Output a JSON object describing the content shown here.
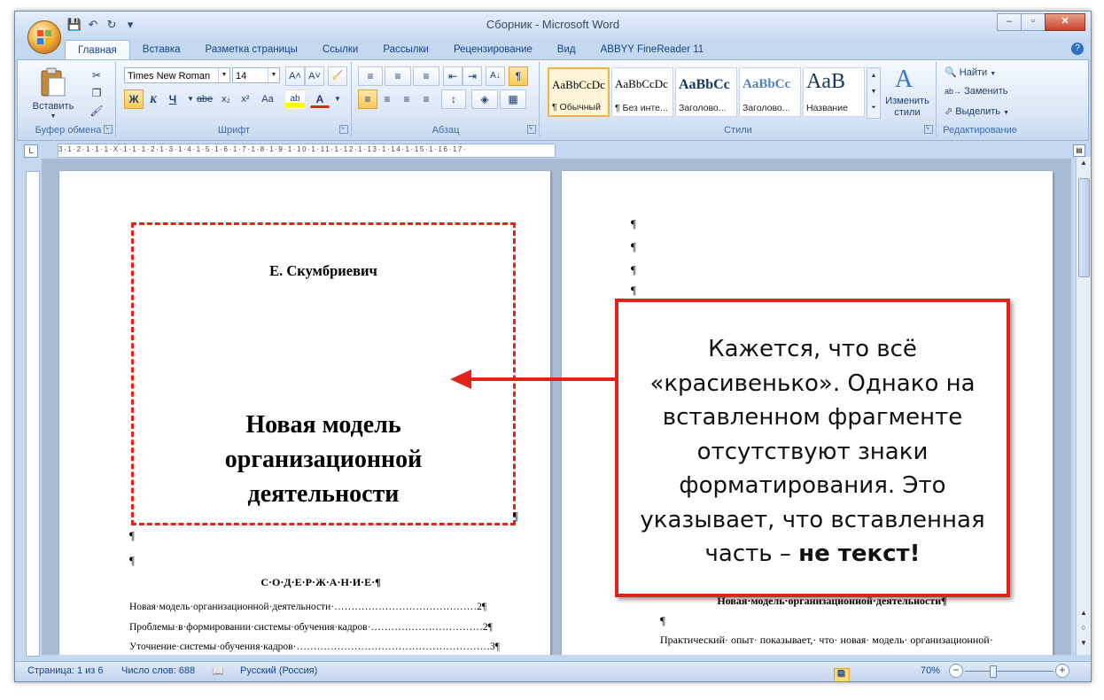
{
  "window": {
    "title": "Сборник - Microsoft Word",
    "controls": {
      "minimize": "–",
      "maximize": "▫",
      "close": "✕"
    }
  },
  "quick_access": [
    "save-icon",
    "undo-icon",
    "redo-icon",
    "customize-icon"
  ],
  "tabs": [
    "Главная",
    "Вставка",
    "Разметка страницы",
    "Ссылки",
    "Рассылки",
    "Рецензирование",
    "Вид",
    "ABBYY FineReader 11"
  ],
  "ribbon": {
    "clipboard": {
      "paste_label": "Вставить",
      "group_label": "Буфер обмена"
    },
    "font": {
      "font_name": "Times New Roman",
      "font_size": "14",
      "group_label": "Шрифт",
      "bold": "Ж",
      "italic": "К",
      "underline": "Ч",
      "strike": "abe",
      "sub": "x₂",
      "sup": "x²",
      "case": "Aa",
      "grow": "A˄",
      "shrink": "A˅",
      "clear": "A"
    },
    "paragraph": {
      "group_label": "Абзац"
    },
    "styles": {
      "group_label": "Стили",
      "items": [
        {
          "sample": "AaBbCcDc",
          "name": "¶ Обычный"
        },
        {
          "sample": "AaBbCcDc",
          "name": "¶ Без инте..."
        },
        {
          "sample": "AaBbCc",
          "name": "Заголово..."
        },
        {
          "sample": "AaBbCc",
          "name": "Заголово..."
        },
        {
          "sample": "AaB",
          "name": "Название"
        }
      ],
      "change_styles_line1": "Изменить",
      "change_styles_line2": "стили"
    },
    "editing": {
      "group_label": "Редактирование",
      "find": "Найти",
      "replace": "Заменить",
      "select": "Выделить"
    }
  },
  "ruler": {
    "tab_selector": "L",
    "marks": "3·1·2·1·1·1·X·1·1·1·2·1·3·1·4·1·5·1·6·1·7·1·8·1·9·1·10·1·11·1·12·1·13·1·14·1·15·1·16·17·"
  },
  "page1": {
    "author": "Е. Скумбриевич",
    "title_line1": "Новая модель",
    "title_line2": "организационной",
    "title_line3": "деятельности",
    "pilcrow": "¶",
    "contents_heading": "С·О·Д·Е·Р·Ж·А·Н·И·Е·¶",
    "toc": [
      {
        "text": "Новая·модель·организационной·деятельности·",
        "dots": "……………………………………",
        "page": "2¶"
      },
      {
        "text": "Проблемы·в·формировании·системы·обучения·кадров·",
        "dots": "……………………………",
        "page": "2¶"
      },
      {
        "text": "Уточнение·системы·обучения·кадров·",
        "dots": "…………………………………………………",
        "page": "3¶"
      }
    ]
  },
  "page2": {
    "pilcrow": "¶",
    "heading": "Новая·модель·организационной·деятельности¶",
    "body": "Практический· опыт· показывает,· что· новая· модель· организационной·"
  },
  "callout": {
    "text_plain": "Кажется, что всё «красивенько». Однако на вставленном фрагменте отсутствуют знаки форматирования. Это указывает, что вставленная часть – ",
    "text_bold": "не текст!"
  },
  "statusbar": {
    "page": "Страница: 1 из 6",
    "words": "Число слов: 688",
    "language": "Русский (Россия)",
    "zoom": "70%"
  },
  "colors": {
    "accent_red": "#e2231a",
    "ribbon_blue": "#15428b"
  }
}
